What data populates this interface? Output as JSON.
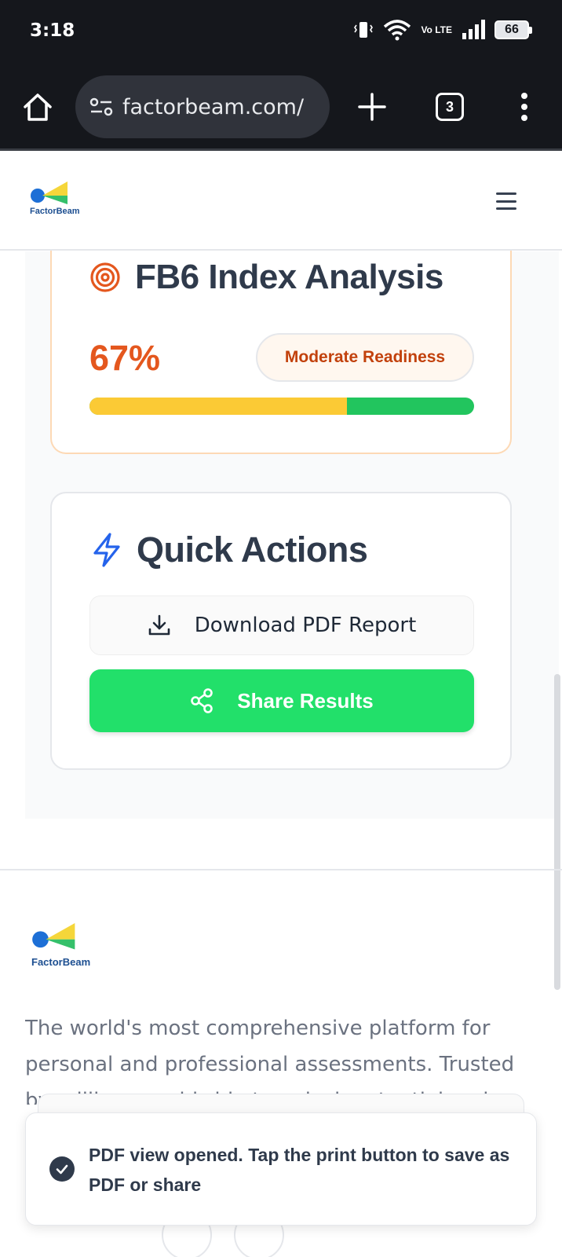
{
  "status_bar": {
    "time": "3:18",
    "network_label": "Vo LTE",
    "battery": "66"
  },
  "browser": {
    "url": "factorbeam.com/",
    "tab_count": "3"
  },
  "header": {
    "logo_text": "FactorBeam"
  },
  "fb6": {
    "title": "FB6 Index Analysis",
    "score_label": "67%",
    "score_value": 0.67,
    "badge": "Moderate Readiness",
    "colors": {
      "fill": "#fbca35",
      "remainder": "#22c55e",
      "accent": "#e4571e"
    }
  },
  "quick_actions": {
    "title": "Quick Actions",
    "download_label": "Download PDF Report",
    "share_label": "Share Results",
    "colors": {
      "share": "#22e06a"
    }
  },
  "footer": {
    "logo_text": "FactorBeam",
    "description": "The world's most comprehensive platform for personal and professional assessments. Trusted by millions worldwide to unlock potential and"
  },
  "toast": {
    "message": "PDF view opened. Tap the print button to save as PDF or share"
  }
}
